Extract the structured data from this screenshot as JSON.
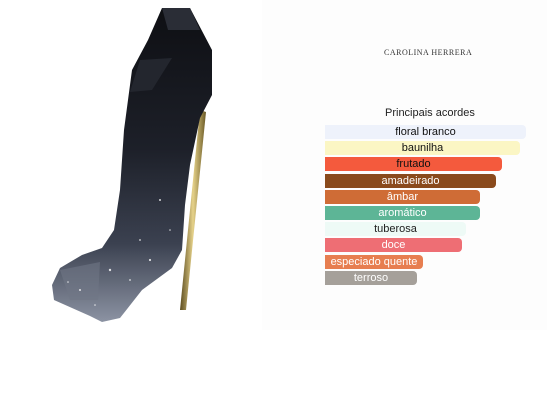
{
  "brand": "CAROLINA HERRERA",
  "accords": {
    "title": "Principais acordes",
    "items": [
      {
        "label": "floral branco",
        "width_pct": 100,
        "color": "#eef2fb",
        "text_color": "#111111"
      },
      {
        "label": "baunilha",
        "width_pct": 97,
        "color": "#fbf6c4",
        "text_color": "#111111"
      },
      {
        "label": "frutado",
        "width_pct": 88,
        "color": "#f45a3d",
        "text_color": "#111111"
      },
      {
        "label": "amadeirado",
        "width_pct": 85,
        "color": "#8a4a1c",
        "text_color": "#ffffff"
      },
      {
        "label": "âmbar",
        "width_pct": 77,
        "color": "#cf6c36",
        "text_color": "#ffffff"
      },
      {
        "label": "aromático",
        "width_pct": 77,
        "color": "#5db596",
        "text_color": "#ffffff"
      },
      {
        "label": "tuberosa",
        "width_pct": 70,
        "color": "#eefaf6",
        "text_color": "#222222"
      },
      {
        "label": "doce",
        "width_pct": 68,
        "color": "#ee6e74",
        "text_color": "#ffffff"
      },
      {
        "label": "especiado quente",
        "width_pct": 49,
        "color": "#e77e50",
        "text_color": "#ffffff"
      },
      {
        "label": "terroso",
        "width_pct": 46,
        "color": "#a5a09a",
        "text_color": "#ffffff"
      }
    ]
  }
}
